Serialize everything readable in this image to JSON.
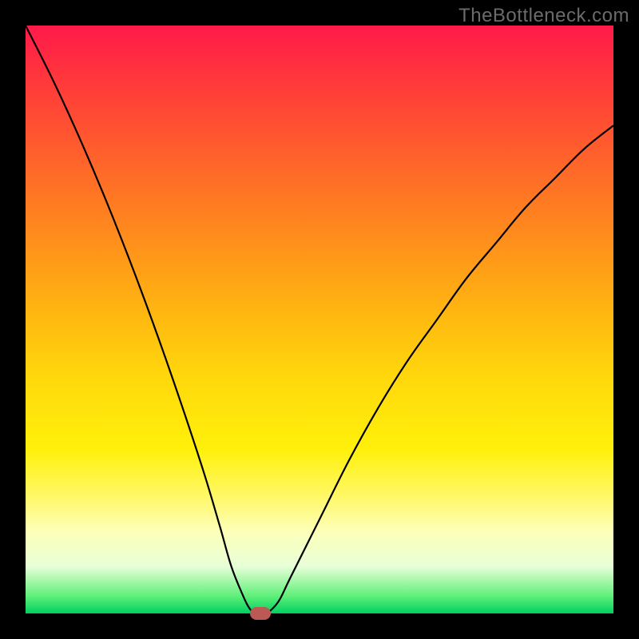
{
  "watermark": "TheBottleneck.com",
  "chart_data": {
    "type": "line",
    "title": "",
    "xlabel": "",
    "ylabel": "",
    "xlim": [
      0,
      100
    ],
    "ylim": [
      0,
      100
    ],
    "grid": false,
    "legend": false,
    "series": [
      {
        "name": "curve",
        "x": [
          0,
          5,
          10,
          15,
          20,
          25,
          30,
          33,
          35,
          37,
          38,
          39,
          40,
          41,
          43,
          45,
          50,
          55,
          60,
          65,
          70,
          75,
          80,
          85,
          90,
          95,
          100
        ],
        "values": [
          100,
          90,
          79,
          67,
          54,
          40,
          25,
          15,
          8,
          3,
          1,
          0,
          0,
          0,
          2,
          6,
          16,
          26,
          35,
          43,
          50,
          57,
          63,
          69,
          74,
          79,
          83
        ]
      }
    ],
    "marker": {
      "x": 40,
      "y": 0,
      "color": "#bb5a55"
    },
    "gradient_stops": [
      {
        "pos": 0,
        "color": "#ff1a4a"
      },
      {
        "pos": 50,
        "color": "#ffd80c"
      },
      {
        "pos": 86,
        "color": "#fdffb8"
      },
      {
        "pos": 100,
        "color": "#00d060"
      }
    ]
  }
}
